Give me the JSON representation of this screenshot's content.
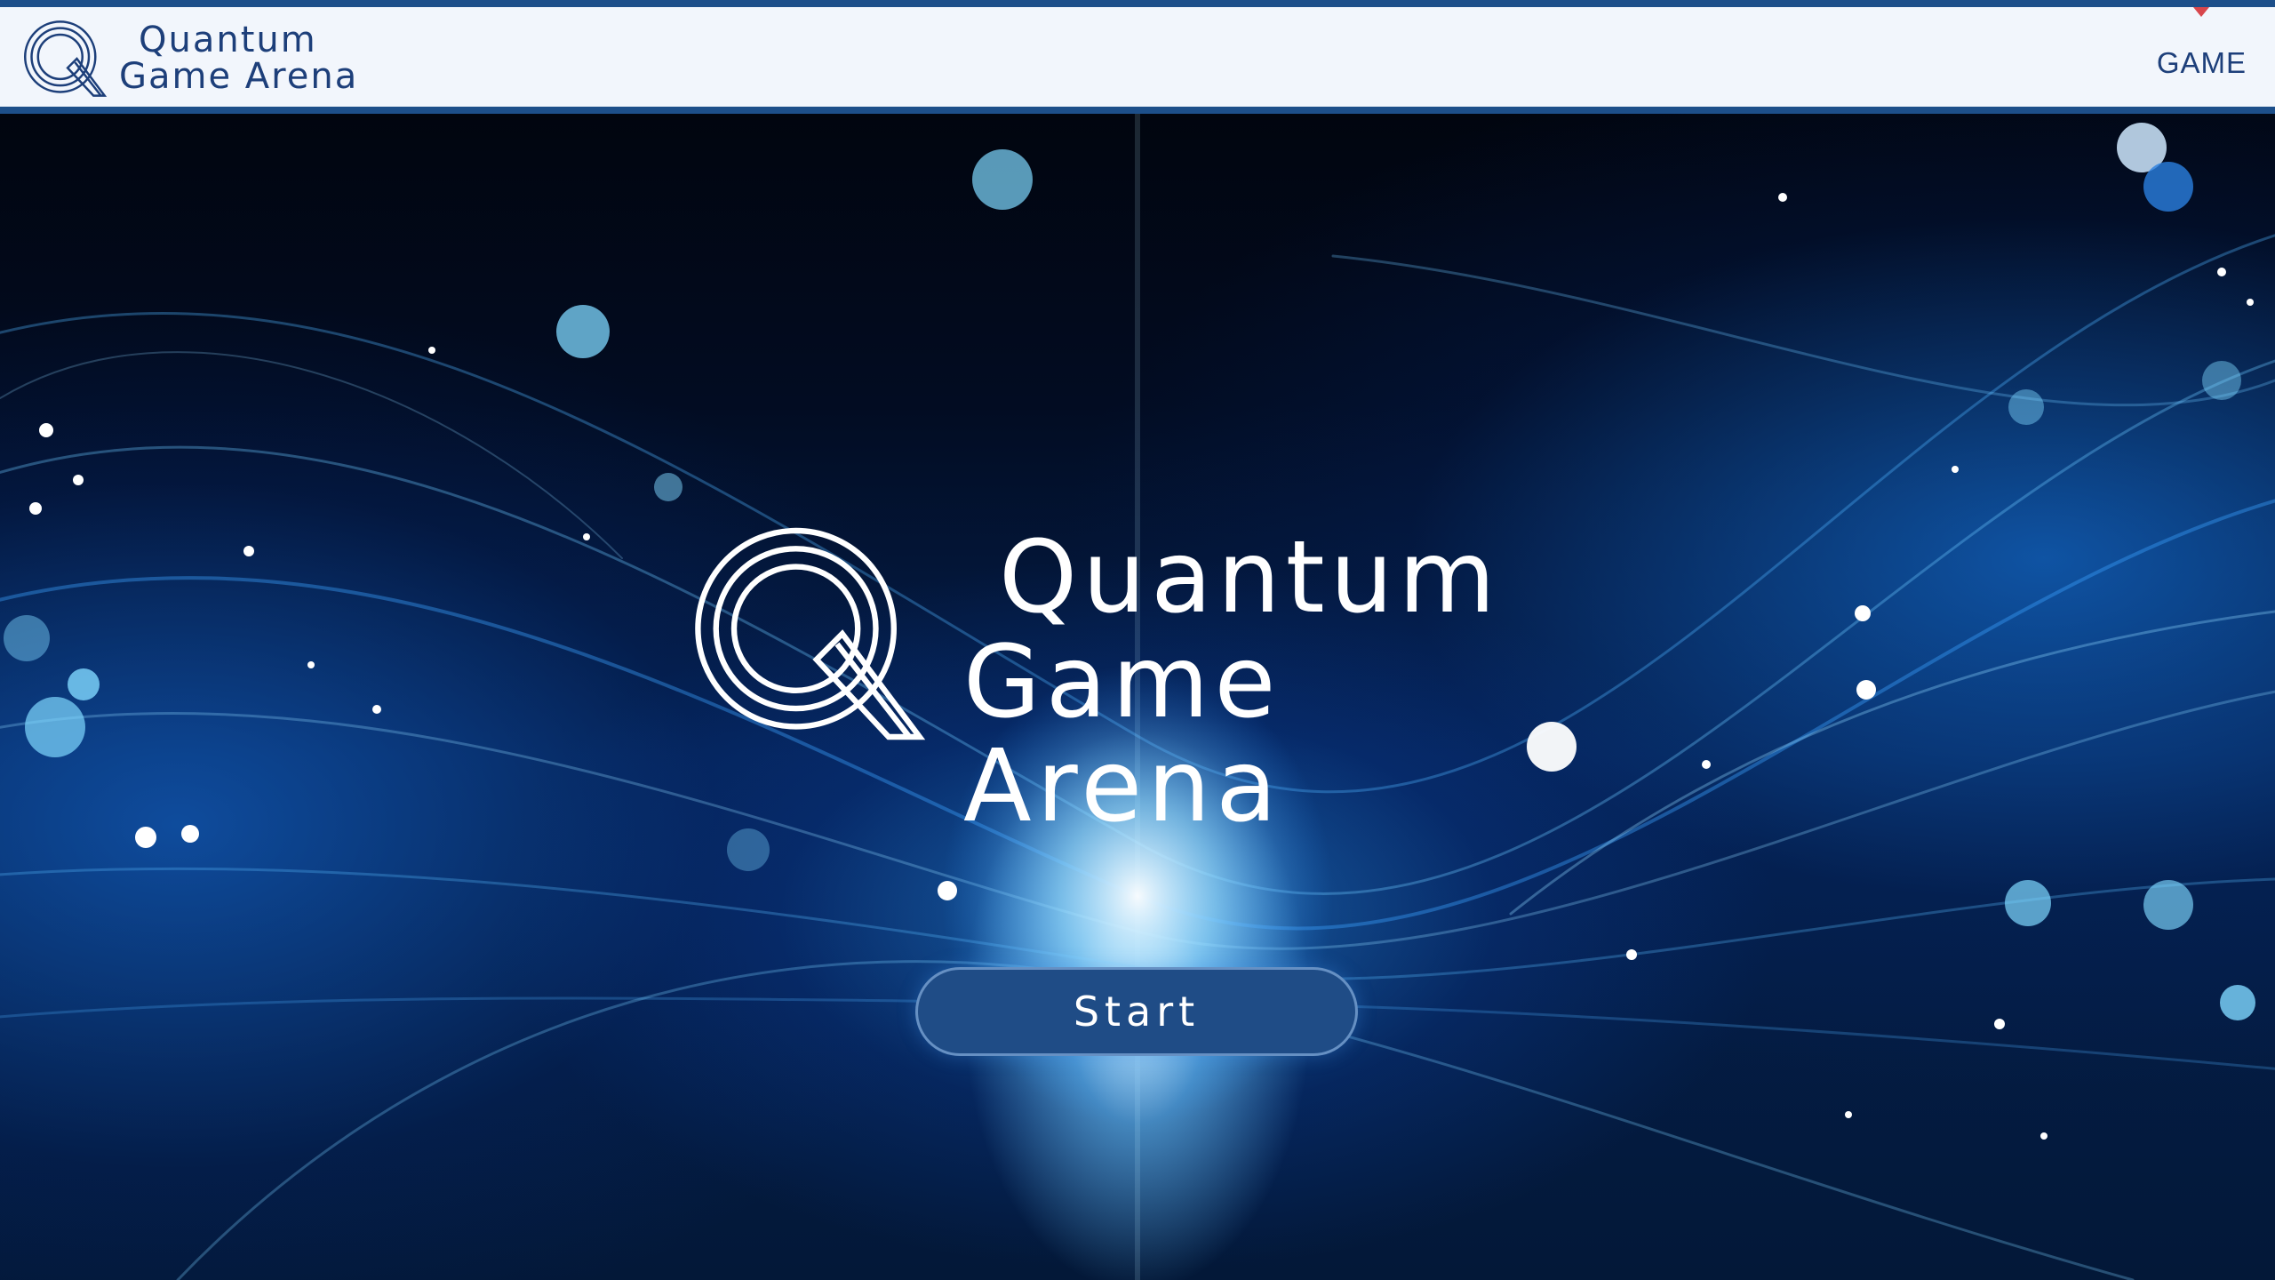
{
  "header": {
    "brand": {
      "line1": "Quantum",
      "line2": "Game Arena",
      "icon": "q-logo-icon"
    },
    "nav": {
      "game_label": "GAME",
      "marker_icon": "active-marker-icon"
    },
    "colors": {
      "bar": "#f2f6fc",
      "accent": "#1d4f8a",
      "text": "#1d3f7a",
      "marker": "#d8464c"
    }
  },
  "hero": {
    "title_line1": "Quantum",
    "title_line2": "Game Arena",
    "logo_icon": "q-logo-icon",
    "start_label": "Start",
    "colors": {
      "button": "#1f4c86",
      "title": "#ffffff"
    }
  }
}
